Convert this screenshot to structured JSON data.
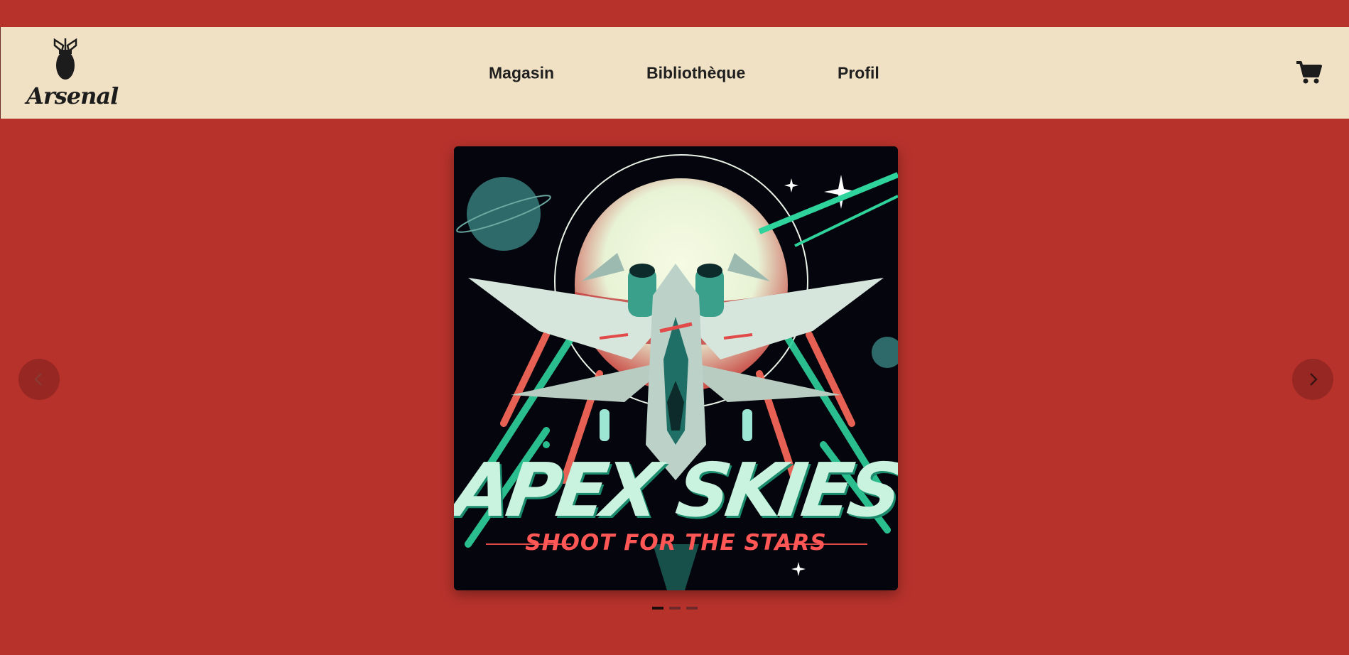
{
  "brand": {
    "name": "Arsenal",
    "logo_icon": "bomb-icon"
  },
  "nav": {
    "items": [
      {
        "label": "Magasin"
      },
      {
        "label": "Bibliothèque"
      },
      {
        "label": "Profil"
      }
    ]
  },
  "cart": {
    "icon": "cart-icon"
  },
  "carousel": {
    "prev_icon": "chevron-left-icon",
    "next_icon": "chevron-right-icon",
    "slide": {
      "title": "APEX SKIES",
      "subtitle": "SHOOT FOR THE STARS"
    },
    "slide_count": 3,
    "active_index": 0
  },
  "colors": {
    "background": "#b8322c",
    "header": "#f1e1c4",
    "text": "#1f1f1f",
    "title_mint": "#c9f3df",
    "subtitle_red": "#ff5656"
  }
}
